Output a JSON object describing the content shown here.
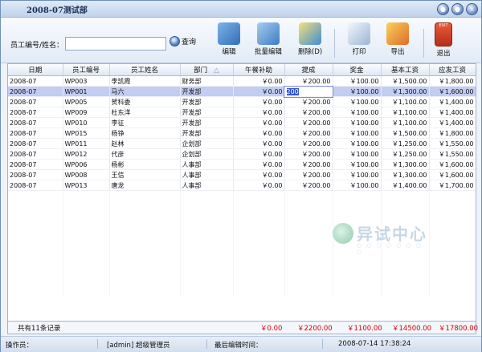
{
  "window": {
    "title": "2008-07测试部"
  },
  "window_buttons": [
    "●",
    "●",
    "×"
  ],
  "search": {
    "label": "员工编号/姓名：",
    "value": "",
    "button": "查询"
  },
  "toolbar": {
    "edit": "编辑",
    "batch_edit": "批量编辑",
    "delete": "删除(D)",
    "print": "打印",
    "export": "导出",
    "exit": "退出"
  },
  "icon_text": {
    "exit_sign": "EXIT"
  },
  "table": {
    "columns": [
      "日期",
      "员工编号",
      "员工姓名",
      "部门",
      "午餐补助",
      "提成",
      "奖金",
      "基本工资",
      "应发工资"
    ],
    "sort_indicator": "△",
    "rows": [
      [
        "2008-07",
        "WP003",
        "李凯霞",
        "财务部",
        "￥0.00",
        "￥200.00",
        "￥100.00",
        "￥1,500.00",
        "￥1,800.00"
      ],
      [
        "2008-07",
        "WP001",
        "马六",
        "开发部",
        "￥0.00",
        "200",
        "￥100.00",
        "￥1,300.00",
        "￥1,600.00"
      ],
      [
        "2008-07",
        "WP005",
        "贺科委",
        "开发部",
        "￥0.00",
        "￥200.00",
        "￥100.00",
        "￥1,100.00",
        "￥1,400.00"
      ],
      [
        "2008-07",
        "WP009",
        "杜东洋",
        "开发部",
        "￥0.00",
        "￥200.00",
        "￥100.00",
        "￥1,100.00",
        "￥1,400.00"
      ],
      [
        "2008-07",
        "WP010",
        "李征",
        "开发部",
        "￥0.00",
        "￥200.00",
        "￥100.00",
        "￥1,100.00",
        "￥1,400.00"
      ],
      [
        "2008-07",
        "WP015",
        "杨铮",
        "开发部",
        "￥0.00",
        "￥200.00",
        "￥100.00",
        "￥1,500.00",
        "￥1,800.00"
      ],
      [
        "2008-07",
        "WP011",
        "赵林",
        "企划部",
        "￥0.00",
        "￥200.00",
        "￥100.00",
        "￥1,250.00",
        "￥1,550.00"
      ],
      [
        "2008-07",
        "WP012",
        "代彦",
        "企划部",
        "￥0.00",
        "￥200.00",
        "￥100.00",
        "￥1,250.00",
        "￥1,550.00"
      ],
      [
        "2008-07",
        "WP006",
        "杨彬",
        "人事部",
        "￥0.00",
        "￥200.00",
        "￥100.00",
        "￥1,300.00",
        "￥1,600.00"
      ],
      [
        "2008-07",
        "WP008",
        "王信",
        "人事部",
        "￥0.00",
        "￥200.00",
        "￥100.00",
        "￥1,300.00",
        "￥1,600.00"
      ],
      [
        "2008-07",
        "WP013",
        "唐龙",
        "人事部",
        "￥0.00",
        "￥200.00",
        "￥100.00",
        "￥1,400.00",
        "￥1,700.00"
      ]
    ],
    "selected_row": 1
  },
  "totals": {
    "count_label": "共有11条记录",
    "lunch": "￥0.00",
    "commission": "￥2200.00",
    "bonus": "￥1100.00",
    "base": "￥14500.00",
    "gross": "￥17800.00"
  },
  "status": {
    "operator_label": "操作员：",
    "operator": "[admin] 超级管理员",
    "last_edit_label": "最后编辑时间：",
    "last_edit_time": "2008-07-14 17:38:24"
  },
  "watermark": {
    "text": "异试中心",
    "sub": "○ ○ ○ ○ ○ ○ ○ ○"
  },
  "colors": {
    "accent": "#3355cc",
    "total_red": "#d40000",
    "title_bar": "#bfd3ec"
  }
}
